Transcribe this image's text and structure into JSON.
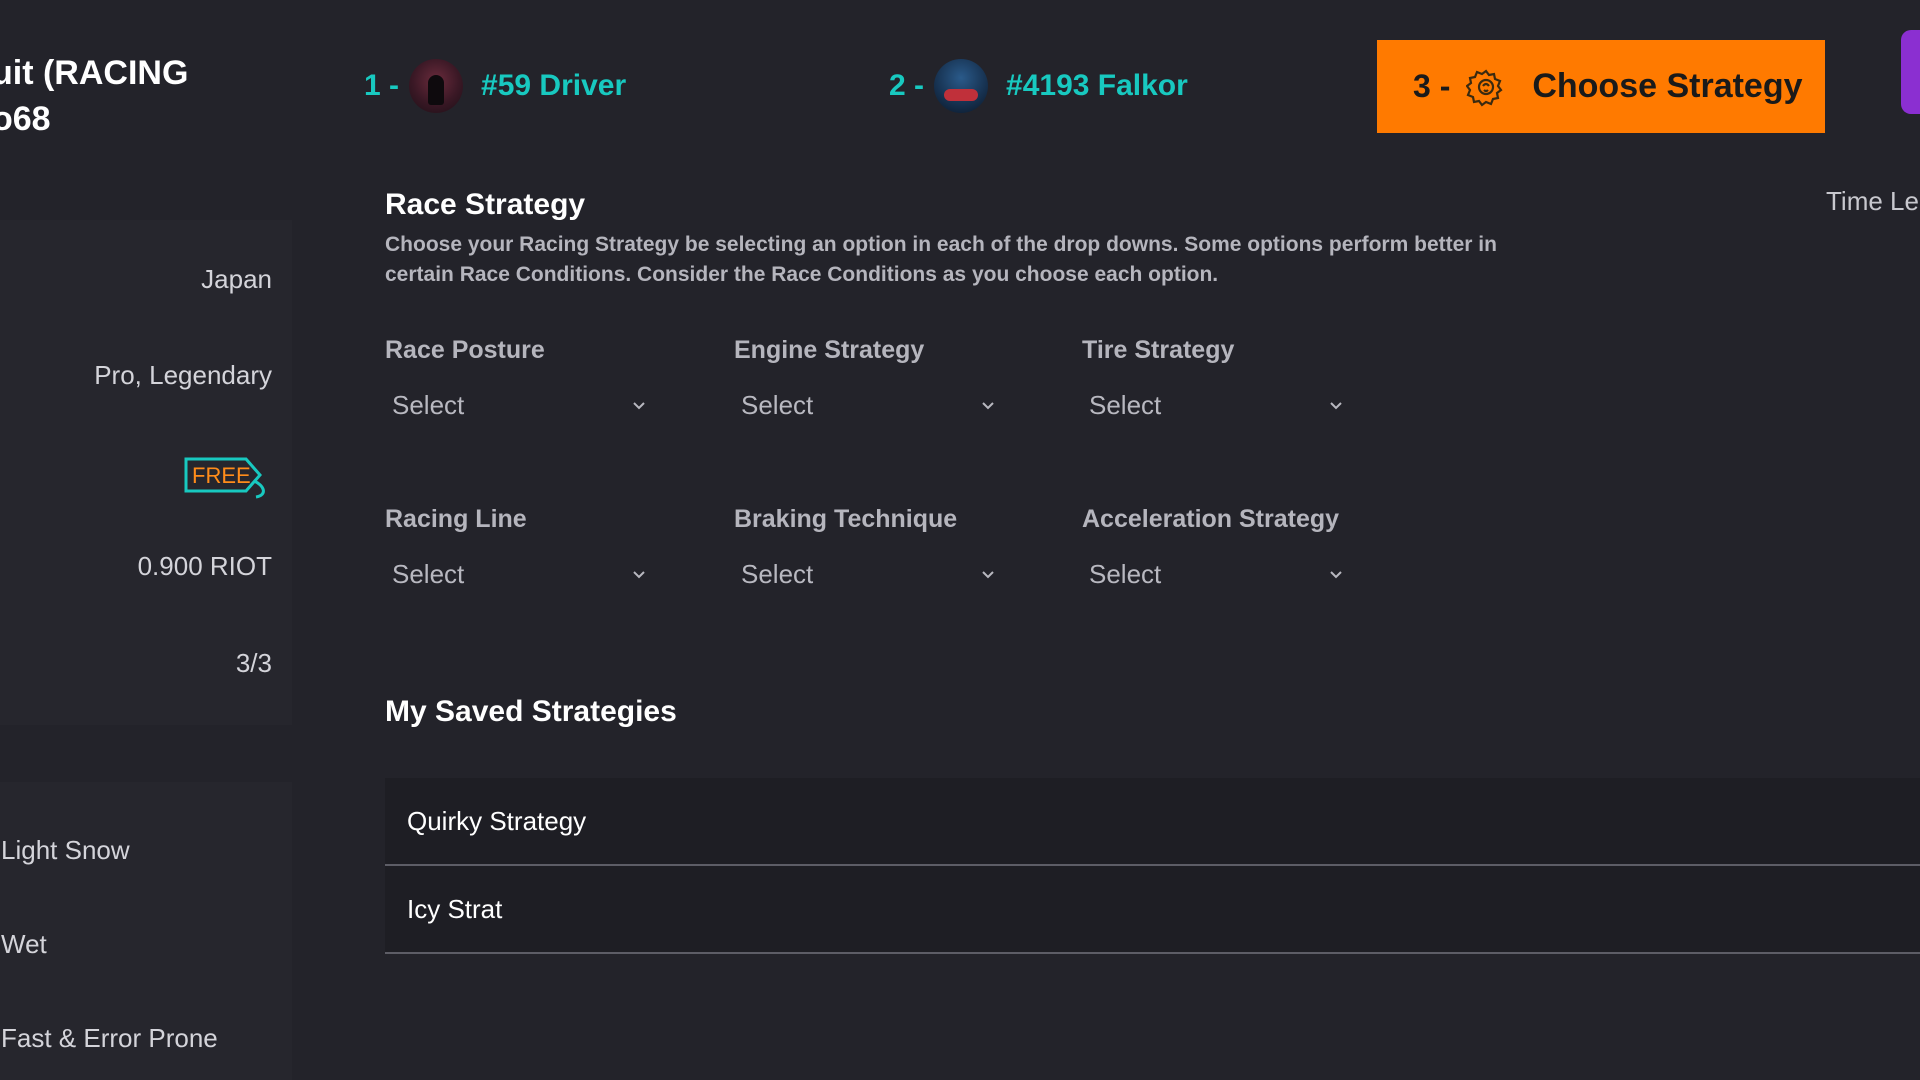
{
  "race": {
    "title_line1": "uit (RACING",
    "title_line2": "o68"
  },
  "info": {
    "location": "Japan",
    "tier": "Pro, Legendary",
    "entry_tag": "FREE",
    "prize": "0.900 RIOT",
    "entries": "3/3"
  },
  "conditions": {
    "weather": "Light Snow",
    "track": "Wet",
    "style": "Fast & Error Prone"
  },
  "steps": [
    {
      "num": "1 -",
      "label": "#59 Driver",
      "icon": "driver-avatar"
    },
    {
      "num": "2 -",
      "label": "#4193 Falkor",
      "icon": "car-avatar"
    },
    {
      "num": "3 -",
      "label": "Choose Strategy",
      "icon": "gear-brain-icon",
      "color": "#ff7a00"
    }
  ],
  "time_left_label": "Time Le",
  "strategy": {
    "title": "Race Strategy",
    "description": "Choose your Racing Strategy be selecting an option in each of the drop downs. Some options perform better in certain Race Conditions. Consider the Race Conditions as you choose each option.",
    "fields": [
      {
        "label": "Race Posture",
        "value": "Select"
      },
      {
        "label": "Engine Strategy",
        "value": "Select"
      },
      {
        "label": "Tire Strategy",
        "value": "Select"
      },
      {
        "label": "Racing Line",
        "value": "Select"
      },
      {
        "label": "Braking Technique",
        "value": "Select"
      },
      {
        "label": "Acceleration Strategy",
        "value": "Select"
      }
    ]
  },
  "saved": {
    "title": "My Saved Strategies",
    "items": [
      "Quirky Strategy",
      "Icy Strat"
    ]
  },
  "colors": {
    "background": "#23232a",
    "accent_teal": "#18c9c0",
    "accent_orange": "#ff7a00",
    "accent_purple": "#8b2fd1"
  }
}
